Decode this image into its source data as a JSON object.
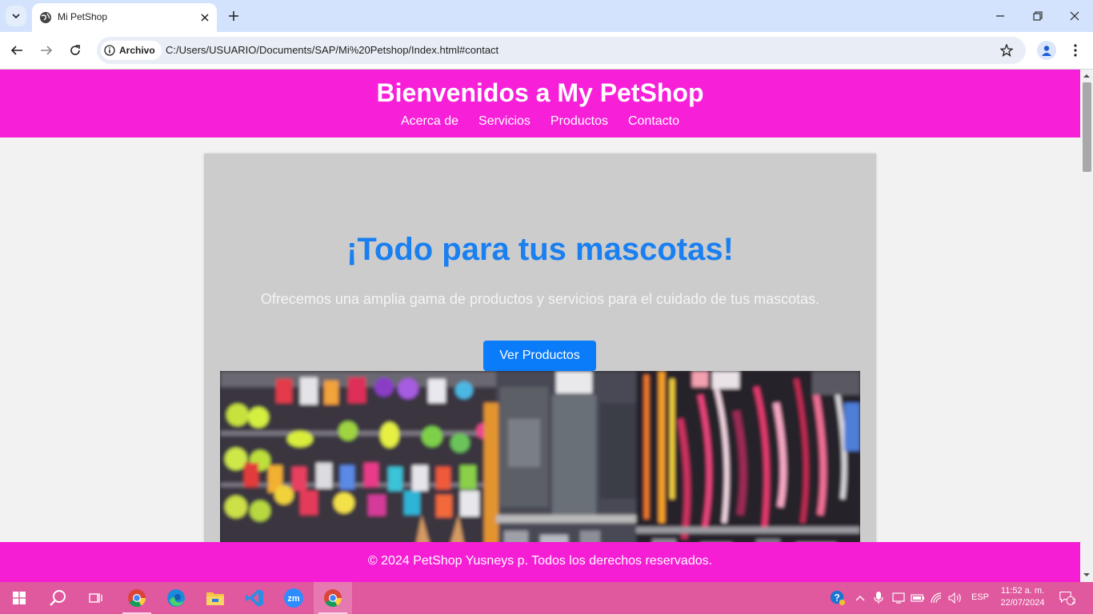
{
  "browser": {
    "tab_title": "Mi PetShop",
    "site_chip": "Archivo",
    "url": "C:/Users/USUARIO/Documents/SAP/Mi%20Petshop/Index.html#contact"
  },
  "site": {
    "title": "Bienvenidos a My PetShop",
    "nav": [
      "Acerca de",
      "Servicios",
      "Productos",
      "Contacto"
    ],
    "hero": {
      "title": "¡Todo para tus mascotas!",
      "subtitle": "Ofrecemos una amplia gama de productos y servicios para el cuidado de tus mascotas.",
      "button": "Ver Productos"
    },
    "footer": "© 2024 PetShop Yusneys p. Todos los derechos reservados."
  },
  "taskbar": {
    "language": "ESP",
    "time": "11:52 a. m.",
    "date": "22/07/2024",
    "notifications": "2"
  },
  "colors": {
    "header": "#f81fd9",
    "footer": "#f51ed5",
    "hero_title": "#1a7ff0",
    "button": "#0a7bf9",
    "taskbar": "#e0589d"
  }
}
